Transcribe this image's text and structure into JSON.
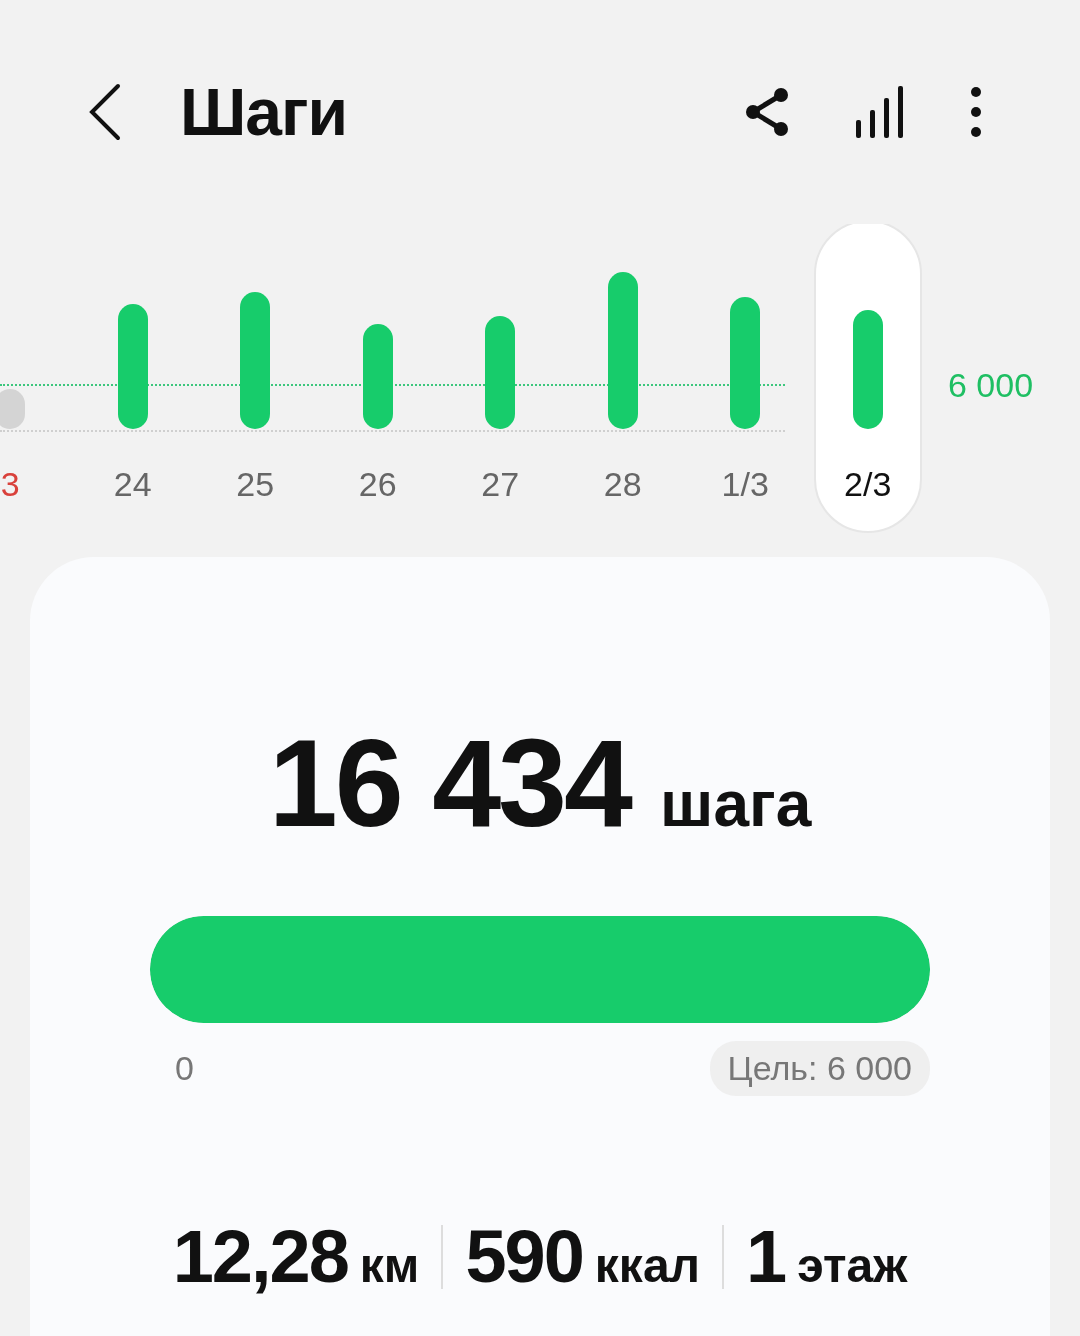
{
  "header": {
    "title": "Шаги"
  },
  "chart": {
    "goal_label": "6 000",
    "days": [
      {
        "label": "3",
        "color": "#d9413b",
        "selected": false
      },
      {
        "label": "24",
        "color": "#666666",
        "selected": false
      },
      {
        "label": "25",
        "color": "#666666",
        "selected": false
      },
      {
        "label": "26",
        "color": "#666666",
        "selected": false
      },
      {
        "label": "27",
        "color": "#666666",
        "selected": false
      },
      {
        "label": "28",
        "color": "#666666",
        "selected": false
      },
      {
        "label": "1/3",
        "color": "#666666",
        "selected": false
      },
      {
        "label": "2/3",
        "color": "#111111",
        "selected": true
      }
    ]
  },
  "summary": {
    "count": "16 434",
    "unit": "шага",
    "level": 1,
    "min_label": "0",
    "goal": "Цель: 6 000",
    "stats": [
      {
        "value": "12,28",
        "unit": "км"
      },
      {
        "value": "590",
        "unit": "ккал"
      },
      {
        "value": "1",
        "unit": "этаж"
      }
    ]
  }
}
